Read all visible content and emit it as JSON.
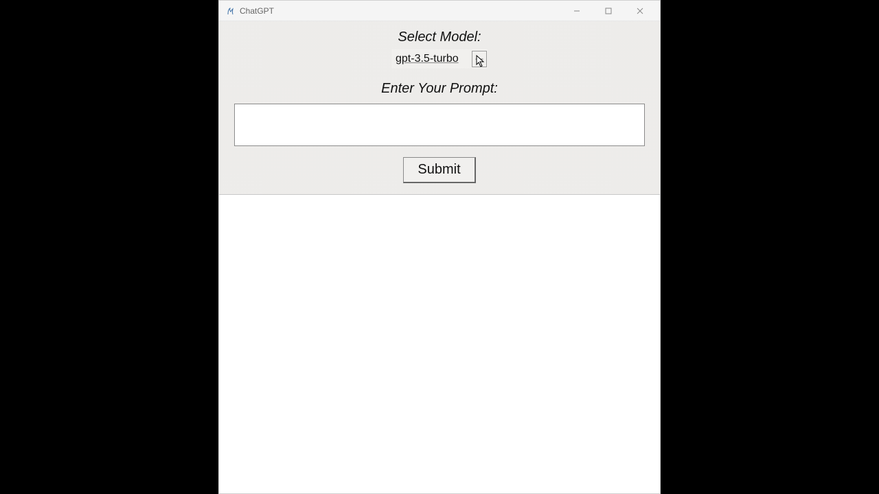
{
  "window": {
    "title": "ChatGPT"
  },
  "form": {
    "model_label": "Select Model:",
    "model_selected": "gpt-3.5-turbo",
    "prompt_label": "Enter Your Prompt:",
    "prompt_value": "",
    "submit_label": "Submit"
  }
}
